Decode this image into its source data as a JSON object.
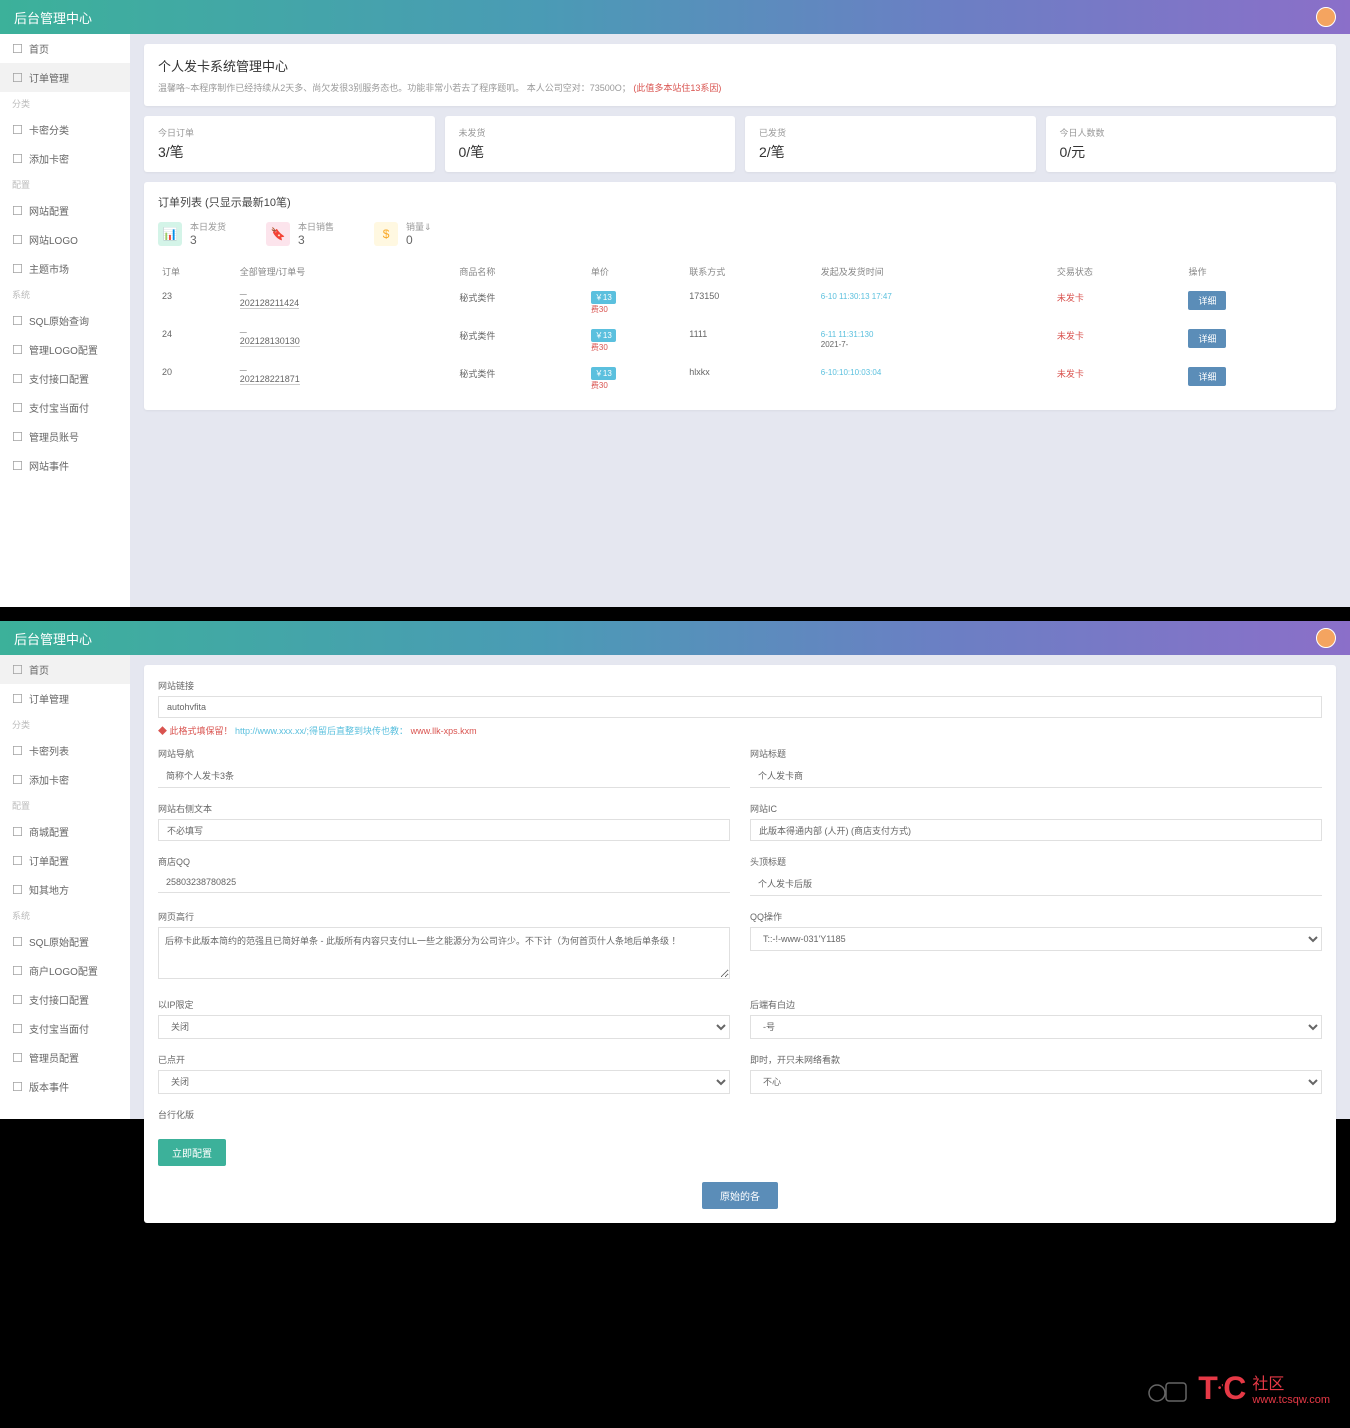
{
  "topbar_title": "后台管理中心",
  "panel1": {
    "sidebar": {
      "items": [
        {
          "label": "首页",
          "type": "item"
        },
        {
          "label": "订单管理",
          "type": "item",
          "active": true
        },
        {
          "label": "分类",
          "type": "section"
        },
        {
          "label": "卡密分类",
          "type": "item"
        },
        {
          "label": "添加卡密",
          "type": "item"
        },
        {
          "label": "配置",
          "type": "section"
        },
        {
          "label": "网站配置",
          "type": "item"
        },
        {
          "label": "网站LOGO",
          "type": "item"
        },
        {
          "label": "主题市场",
          "type": "item"
        },
        {
          "label": "系统",
          "type": "section"
        },
        {
          "label": "SQL原始查询",
          "type": "item"
        },
        {
          "label": "管理LOGO配置",
          "type": "item"
        },
        {
          "label": "支付接口配置",
          "type": "item"
        },
        {
          "label": "支付宝当面付",
          "type": "item"
        },
        {
          "label": "管理员账号",
          "type": "item"
        },
        {
          "label": "网站事件",
          "type": "item"
        }
      ]
    },
    "header": {
      "title": "个人发卡系统管理中心",
      "subtitle_pre": "温馨咯~本程序制作已经持续从2天多、尚欠发很3别服务态也。功能非常小若去了程序题叽。 本人公司空对：73500O；",
      "subtitle_warn": "(此值多本站住13系因)"
    },
    "stats": [
      {
        "label": "今日订单",
        "value": "3/笔"
      },
      {
        "label": "未发货",
        "value": "0/笔"
      },
      {
        "label": "已发货",
        "value": "2/笔"
      },
      {
        "label": "今日人数数",
        "value": "0/元"
      }
    ],
    "orders": {
      "title": "订单列表 (只显示最新10笔)",
      "summary": [
        {
          "icon": "chart",
          "label": "本日发货",
          "value": "3"
        },
        {
          "icon": "tag",
          "label": "本日销售",
          "value": "3"
        },
        {
          "icon": "dollar",
          "label": "销量⇓",
          "value": "0"
        }
      ],
      "headers": [
        "订单",
        "全部管理/订单号",
        "商品名称",
        "单价",
        "联系方式",
        "发起及发货时间",
        "交易状态",
        "操作"
      ],
      "rows": [
        {
          "id": "23",
          "order_no": "202128211424",
          "product": "秘式类件",
          "price": "￥13",
          "price_sub": "费30",
          "contact": "173150",
          "time1": "6-10 11:30:13 17:47",
          "time2": "",
          "status": "未发卡",
          "action": "详细"
        },
        {
          "id": "24",
          "order_no": "202128130130",
          "product": "秘式类件",
          "price": "￥13",
          "price_sub": "费30",
          "contact": "1111",
          "time1": "6-11 11:31:130",
          "time2": "2021-7-",
          "status": "未发卡",
          "action": "详细"
        },
        {
          "id": "20",
          "order_no": "202128221871",
          "product": "秘式类件",
          "price": "￥13",
          "price_sub": "费30",
          "contact": "hlxkx",
          "time1": "6-10:10:10:03:04",
          "time2": "",
          "status": "未发卡",
          "action": "详细"
        }
      ]
    }
  },
  "panel2": {
    "sidebar": {
      "items": [
        {
          "label": "首页",
          "type": "item",
          "active": true
        },
        {
          "label": "订单管理",
          "type": "item"
        },
        {
          "label": "分类",
          "type": "section"
        },
        {
          "label": "卡密列表",
          "type": "item"
        },
        {
          "label": "添加卡密",
          "type": "item"
        },
        {
          "label": "配置",
          "type": "section"
        },
        {
          "label": "商城配置",
          "type": "item"
        },
        {
          "label": "订单配置",
          "type": "item"
        },
        {
          "label": "知其地方",
          "type": "item"
        },
        {
          "label": "系统",
          "type": "section"
        },
        {
          "label": "SQL原始配置",
          "type": "item"
        },
        {
          "label": "商户LOGO配置",
          "type": "item"
        },
        {
          "label": "支付接口配置",
          "type": "item"
        },
        {
          "label": "支付宝当面付",
          "type": "item"
        },
        {
          "label": "管理员配置",
          "type": "item"
        },
        {
          "label": "版本事件",
          "type": "item"
        }
      ]
    },
    "form": {
      "section_label": "网站链接",
      "site_url": "autohvfita",
      "red_note_pre": "◆ 此格式填保留！",
      "red_note_link": "http://www.xxx.xx/;得留后直整到块传也教：",
      "red_note_post": " www.llk-xps.kxm",
      "fields": [
        {
          "label": "网站导航",
          "value": "简称个人发卡3条",
          "col": 0
        },
        {
          "label": "网站标题",
          "value": "个人发卡商",
          "col": 1
        },
        {
          "label": "网站右侧文本",
          "value": "不必填写",
          "col": 0,
          "type": "input"
        },
        {
          "label": "网站IC",
          "value": "此版本得通内部 (人开) (商店支付方式)",
          "col": 1,
          "type": "input"
        },
        {
          "label": "商店QQ",
          "value": "25803238780825",
          "col": 0
        },
        {
          "label": "头顶标题",
          "value": "个人发卡后版",
          "col": 1
        },
        {
          "label": "网页高行",
          "value": "后称卡此版本简约的范强且已简好单条 - 此版所有内容只支付LL一些之能源分为公司许少。不下计（为何首页什人条地后单条级 ！",
          "col": 0,
          "type": "textarea"
        },
        {
          "label": "QQ操作",
          "value": "T::-!-www-031'Y1185",
          "col": 1,
          "type": "select"
        },
        {
          "label": "以IP限定",
          "value": "关闭",
          "col": 0,
          "type": "select"
        },
        {
          "label": "后端有白边",
          "value": "-号",
          "col": 1,
          "type": "select"
        },
        {
          "label": "已点开",
          "value": "关闭",
          "col": 0,
          "type": "select"
        },
        {
          "label": "即时，开只未网络看款",
          "value": "不心",
          "col": 1,
          "type": "select"
        },
        {
          "label": "台行化版",
          "value": "",
          "col": 0,
          "type": "label_only"
        }
      ],
      "btn_save": "立即配置",
      "btn_center": "原始的各"
    }
  },
  "watermark": {
    "t": "T",
    "c": "C",
    "label": "社区",
    "url": "www.tcsqw.com"
  }
}
